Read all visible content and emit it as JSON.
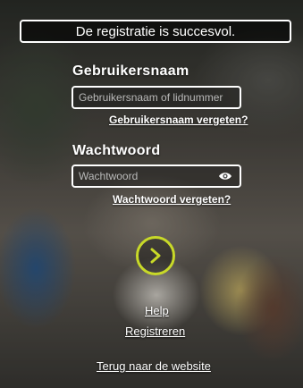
{
  "banner": {
    "text": "De registratie is succesvol."
  },
  "username": {
    "label": "Gebruikersnaam",
    "placeholder": "Gebruikersnaam of lidnummer",
    "forgot_link": "Gebruikersnaam vergeten?"
  },
  "password": {
    "label": "Wachtwoord",
    "placeholder": "Wachtwoord",
    "toggle_icon": "eye-icon",
    "forgot_link": "Wachtwoord vergeten?"
  },
  "submit": {
    "icon": "chevron-right-icon",
    "accent_color": "#c8d928"
  },
  "footer": {
    "help_link": "Help",
    "register_link": "Registreren",
    "back_link": "Terug naar de website"
  }
}
